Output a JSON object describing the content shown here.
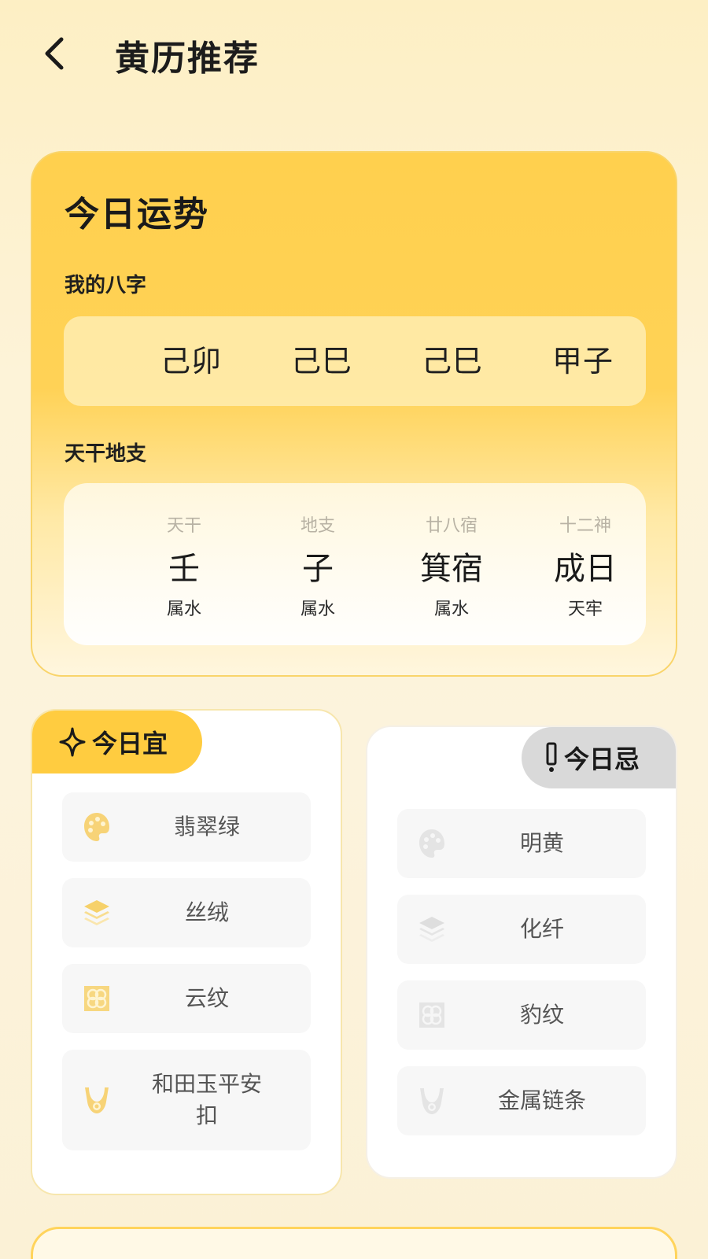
{
  "header": {
    "title": "黄历推荐"
  },
  "fortune": {
    "title": "今日运势",
    "bazi_label": "我的八字",
    "bazi": [
      "己卯",
      "己巳",
      "己巳",
      "甲子"
    ],
    "ganzhi_label": "天干地支",
    "ganzhi": [
      {
        "category": "天干",
        "value": "壬",
        "sub": "属水"
      },
      {
        "category": "地支",
        "value": "子",
        "sub": "属水"
      },
      {
        "category": "廿八宿",
        "value": "箕宿",
        "sub": "属水"
      },
      {
        "category": "十二神",
        "value": "成日",
        "sub": "天牢"
      }
    ]
  },
  "yi": {
    "tag": "今日宜",
    "items": [
      {
        "label": "翡翠绿",
        "icon": "palette-icon"
      },
      {
        "label": "丝绒",
        "icon": "layers-icon"
      },
      {
        "label": "云纹",
        "icon": "pattern-icon"
      },
      {
        "label": "和田玉平安扣",
        "icon": "necklace-icon"
      }
    ]
  },
  "ji": {
    "tag": "今日忌",
    "items": [
      {
        "label": "明黄",
        "icon": "palette-icon"
      },
      {
        "label": "化纤",
        "icon": "layers-icon"
      },
      {
        "label": "豹纹",
        "icon": "pattern-icon"
      },
      {
        "label": "金属链条",
        "icon": "necklace-icon"
      }
    ]
  },
  "colors": {
    "accent_yellow": "#ffcc40",
    "yi_icon": "#f6cf63",
    "ji_icon": "#d8d8d8",
    "ji_tag": "#d9d9d9"
  }
}
